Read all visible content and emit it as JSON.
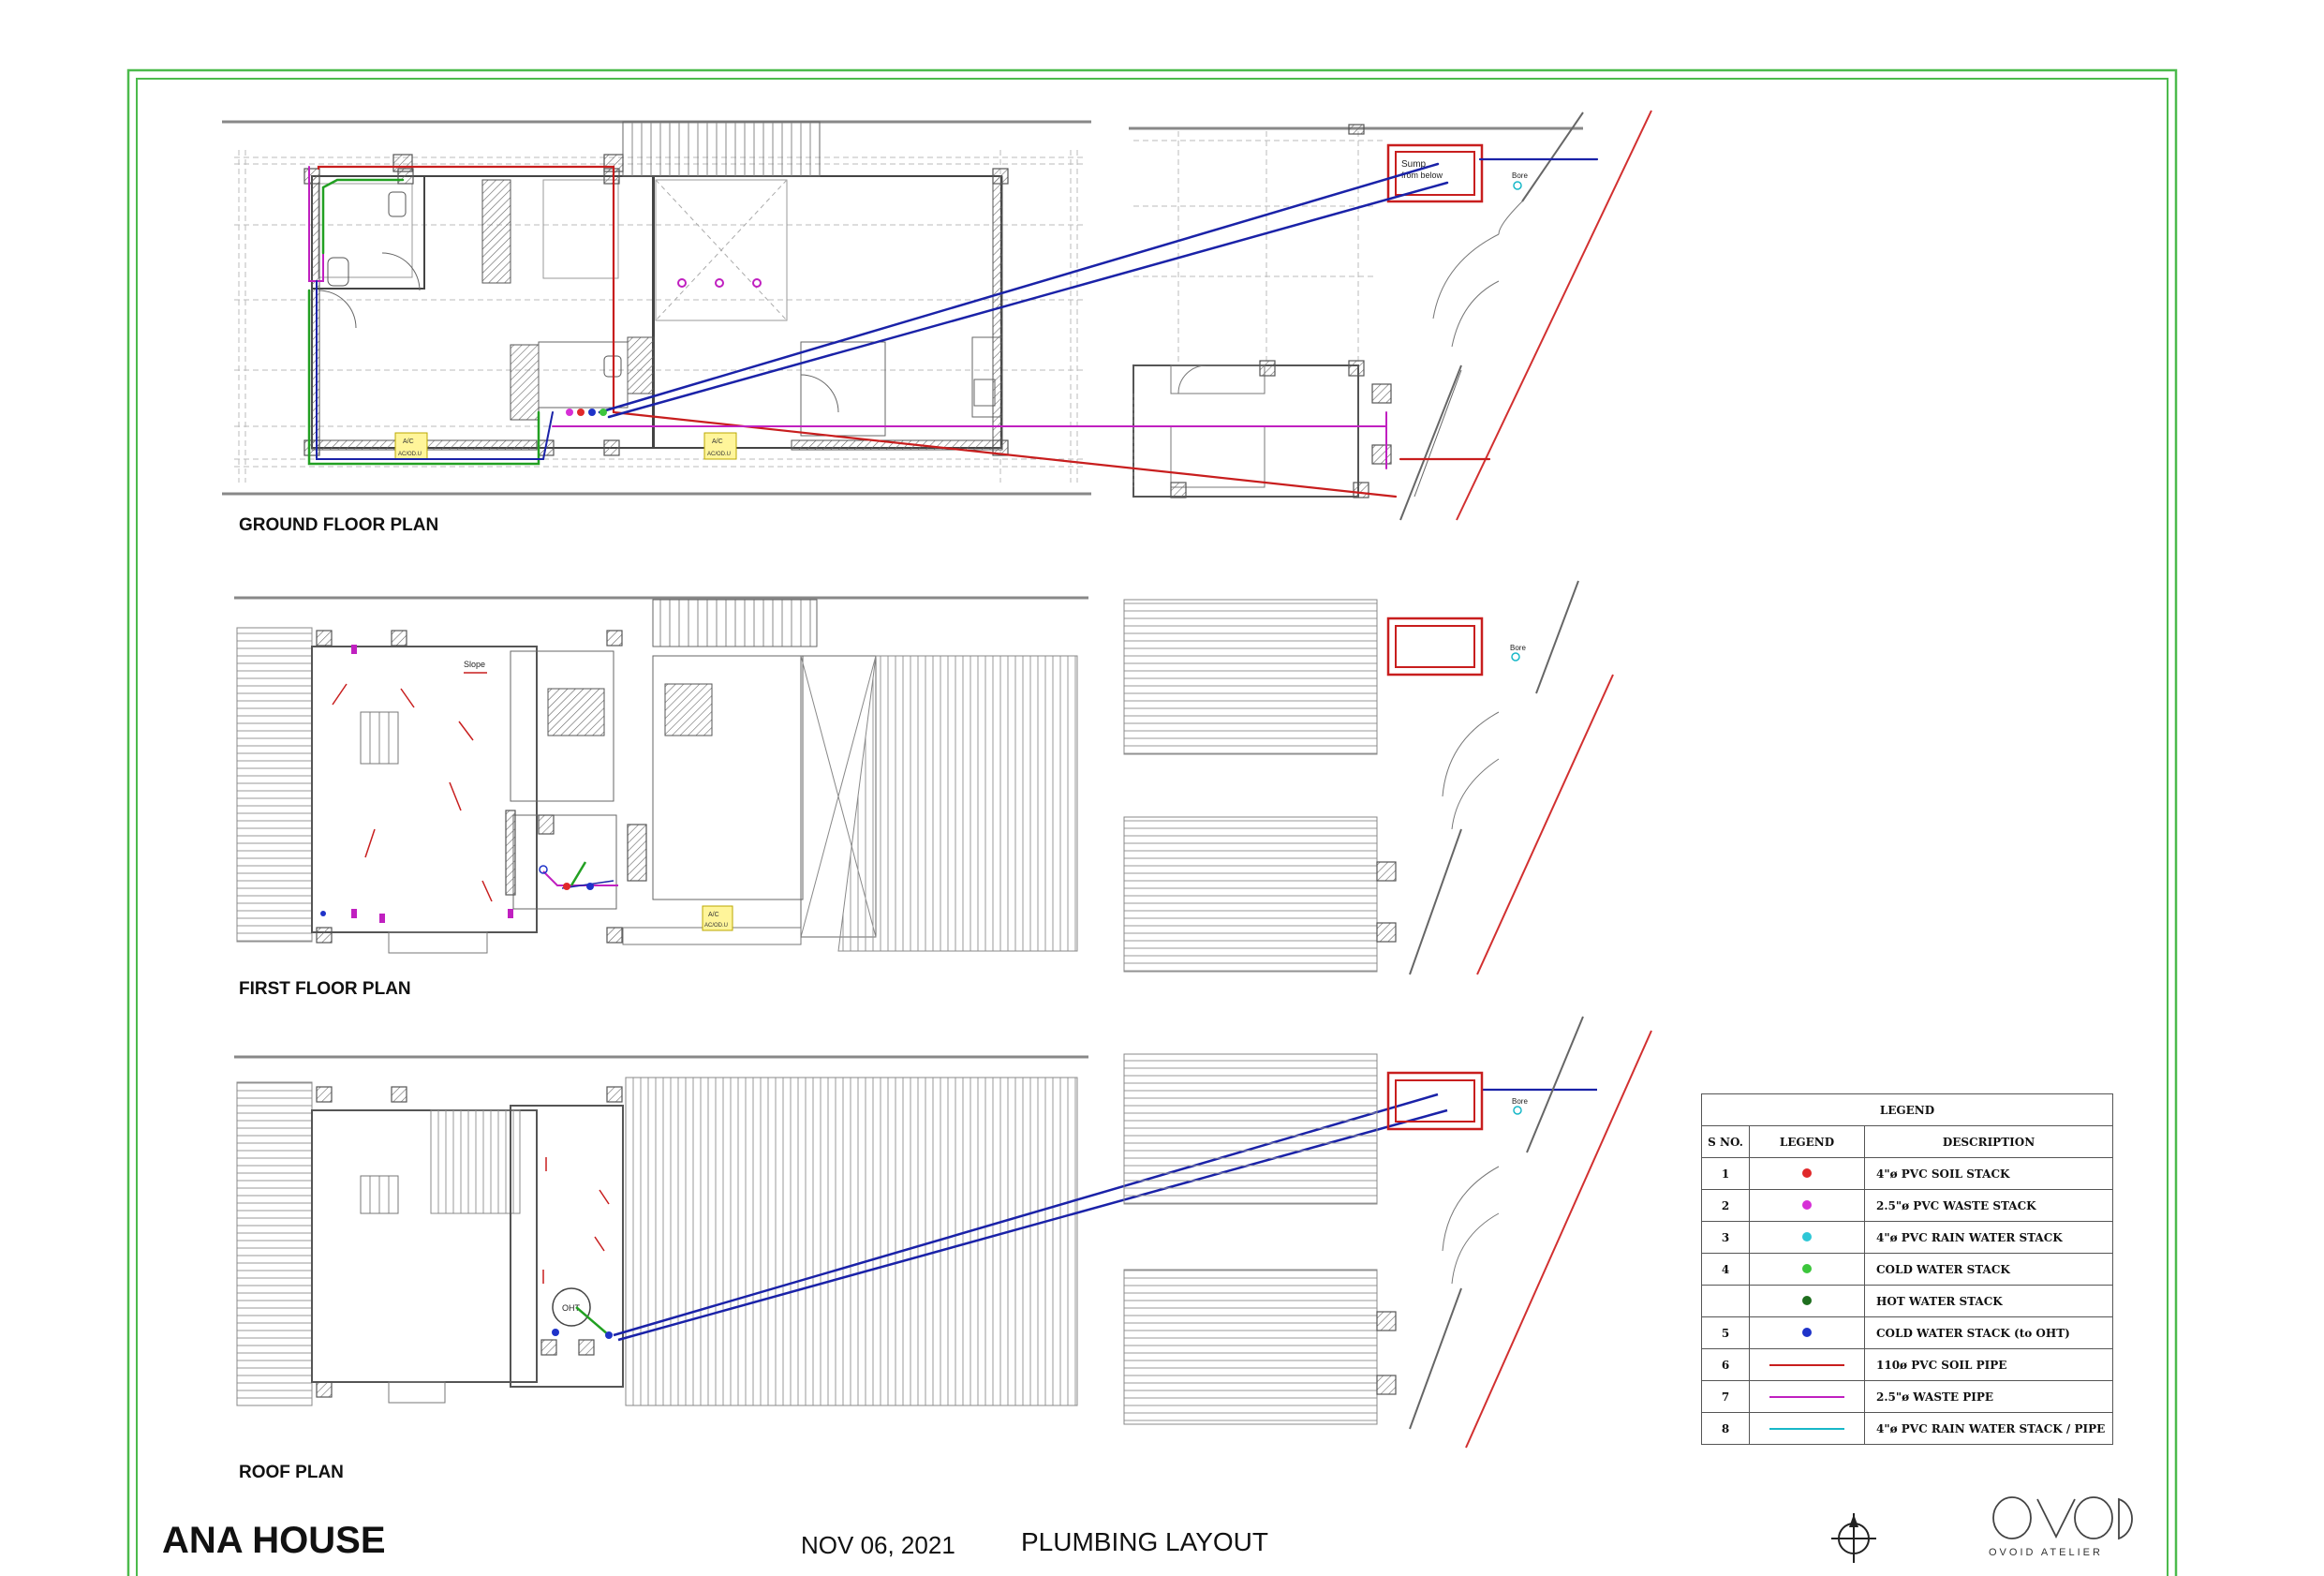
{
  "sheet": {
    "project_name": "ANA HOUSE",
    "date": "NOV 06, 2021",
    "drawing_title": "PLUMBING LAYOUT",
    "studio": "OVOID ATELIER"
  },
  "plans": {
    "ground": "GROUND FLOOR PLAN",
    "first": "FIRST FLOOR PLAN",
    "roof": "ROOF PLAN"
  },
  "annotations": {
    "sump_line1": "Sump",
    "sump_line2": "from below",
    "bore": "Bore",
    "slope": "Slope",
    "ac": "A/C",
    "ac_odu": "AC/OD.U",
    "oht": "OHT"
  },
  "legend": {
    "title": "LEGEND",
    "headers": [
      "S NO.",
      "LEGEND",
      "DESCRIPTION"
    ],
    "rows": [
      {
        "sn": "1",
        "kind": "dot",
        "color": "#e0282a",
        "desc": "4\"ø PVC SOIL STACK"
      },
      {
        "sn": "2",
        "kind": "dot",
        "color": "#d62fd6",
        "desc": "2.5\"ø PVC WASTE STACK"
      },
      {
        "sn": "3",
        "kind": "dot",
        "color": "#2ec7d6",
        "desc": "4\"ø PVC RAIN WATER STACK"
      },
      {
        "sn": "4",
        "kind": "dot",
        "color": "#3cc63c",
        "desc": "COLD WATER STACK"
      },
      {
        "sn": "",
        "kind": "dot",
        "color": "#1e6e1e",
        "desc": "HOT WATER STACK"
      },
      {
        "sn": "5",
        "kind": "dot",
        "color": "#1f33c9",
        "desc": "COLD WATER STACK (to OHT)"
      },
      {
        "sn": "6",
        "kind": "line",
        "color": "#c81e1e",
        "desc": "110ø PVC SOIL PIPE"
      },
      {
        "sn": "7",
        "kind": "line",
        "color": "#c020c0",
        "desc": "2.5\"ø WASTE PIPE"
      },
      {
        "sn": "8",
        "kind": "line",
        "color": "#18b8c8",
        "desc": "4\"ø PVC RAIN WATER STACK / PIPE"
      }
    ]
  },
  "colors": {
    "border": "#4cbb4c",
    "soil_pipe": "#c81e1e",
    "waste_pipe": "#c020c0",
    "cold_water": "#1a22a8",
    "green_pipe": "#22a022",
    "rain_water": "#18b8c8",
    "wall_hatch": "#777777"
  }
}
